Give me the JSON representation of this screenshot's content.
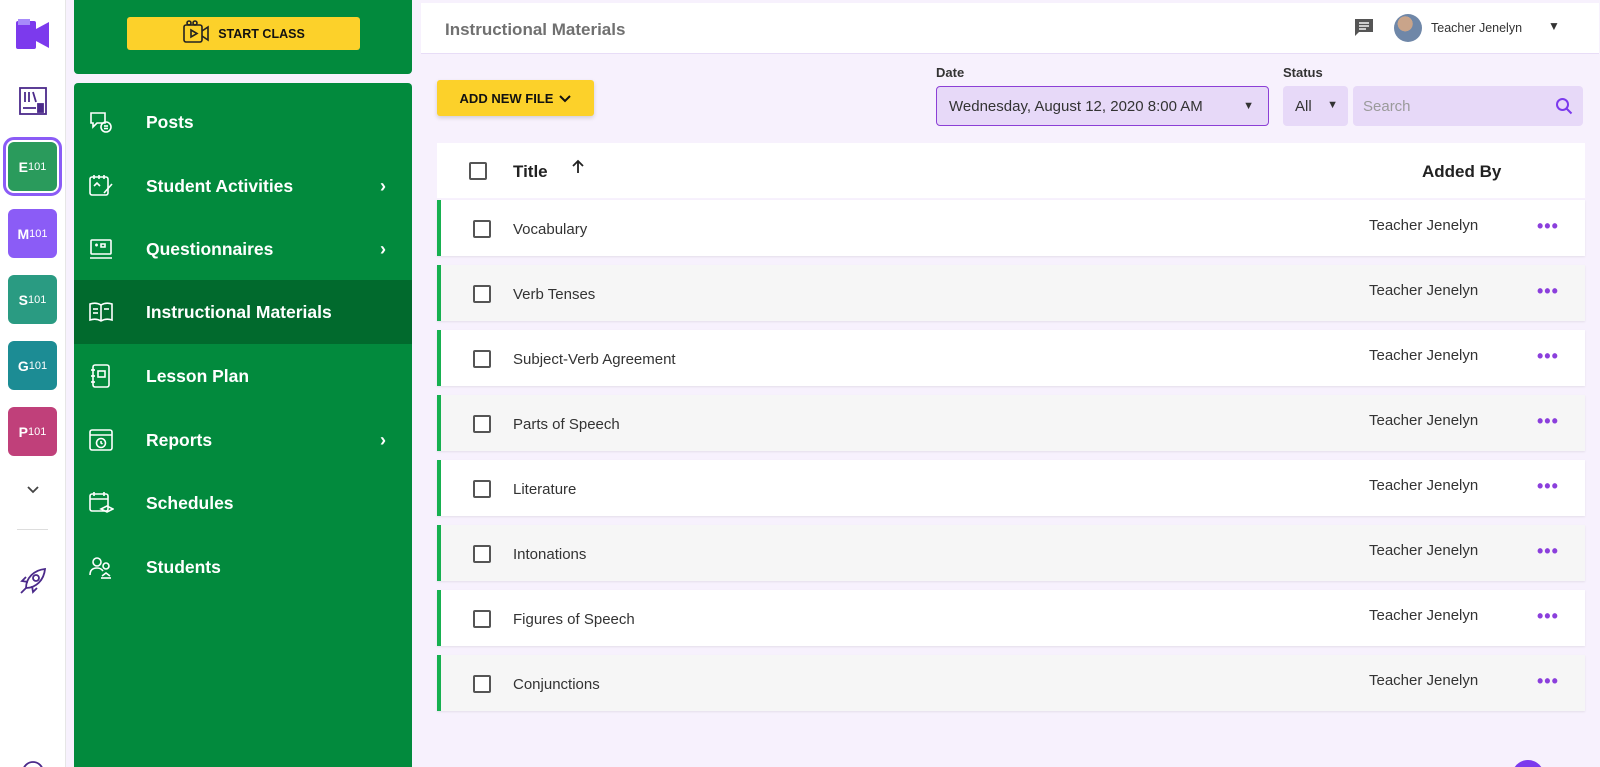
{
  "rail": {
    "courses": [
      {
        "big": "E",
        "small": "101",
        "color": "#2a9b5c"
      },
      {
        "big": "M",
        "small": "101",
        "color": "#8b5cf6"
      },
      {
        "big": "S",
        "small": "101",
        "color": "#2a9b82"
      },
      {
        "big": "G",
        "small": "101",
        "color": "#1c8c94"
      },
      {
        "big": "P",
        "small": "101",
        "color": "#c0407a"
      }
    ]
  },
  "sidebar": {
    "start_label": "START CLASS",
    "items": [
      {
        "label": "Posts"
      },
      {
        "label": "Student Activities"
      },
      {
        "label": "Questionnaires"
      },
      {
        "label": "Instructional Materials"
      },
      {
        "label": "Lesson Plan"
      },
      {
        "label": "Reports"
      },
      {
        "label": "Schedules"
      },
      {
        "label": "Students"
      }
    ]
  },
  "header": {
    "title": "Instructional Materials",
    "user_name": "Teacher Jenelyn"
  },
  "toolbar": {
    "add_label": "ADD NEW FILE",
    "date_label": "Date",
    "date_value": "Wednesday, August 12, 2020 8:00 AM",
    "status_label": "Status",
    "status_value": "All",
    "search_placeholder": "Search"
  },
  "table": {
    "col_title": "Title",
    "col_added": "Added By",
    "rows": [
      {
        "title": "Vocabulary",
        "added_by": "Teacher Jenelyn"
      },
      {
        "title": "Verb Tenses",
        "added_by": "Teacher Jenelyn"
      },
      {
        "title": "Subject-Verb Agreement",
        "added_by": "Teacher Jenelyn"
      },
      {
        "title": "Parts of Speech",
        "added_by": "Teacher Jenelyn"
      },
      {
        "title": "Literature",
        "added_by": "Teacher Jenelyn"
      },
      {
        "title": "Intonations",
        "added_by": "Teacher Jenelyn"
      },
      {
        "title": "Figures of Speech",
        "added_by": "Teacher Jenelyn"
      },
      {
        "title": "Conjunctions",
        "added_by": "Teacher Jenelyn"
      }
    ]
  },
  "colors": {
    "green": "#028a3d",
    "accent": "#8b5cf6",
    "yellow": "#fcd12a"
  }
}
